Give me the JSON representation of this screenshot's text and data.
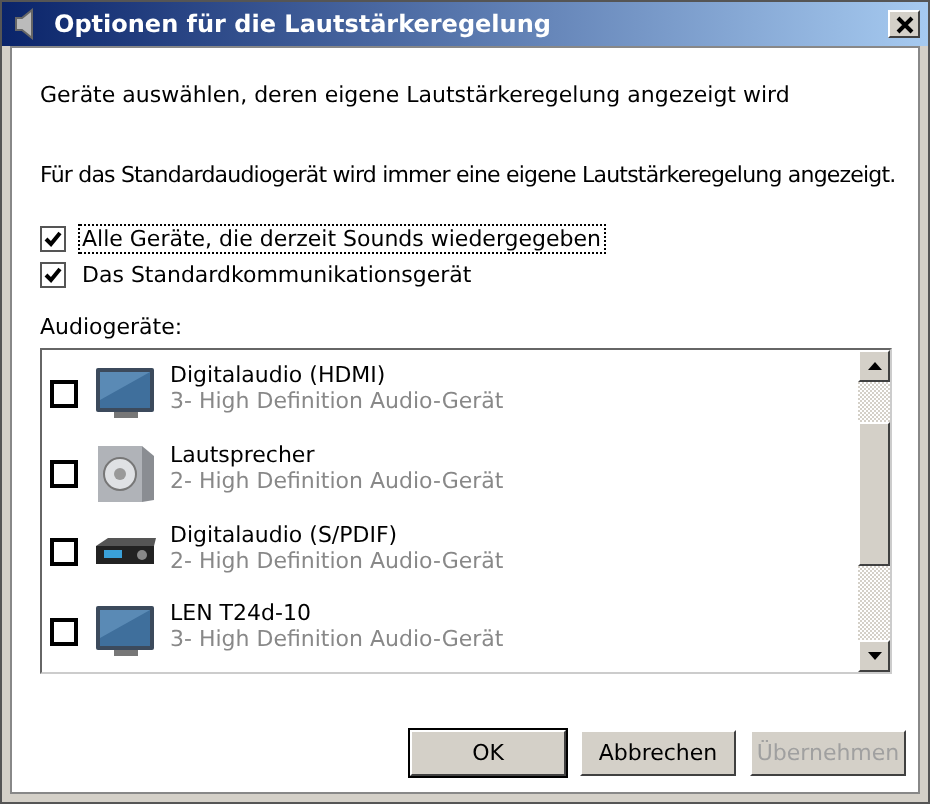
{
  "window": {
    "title": "Optionen für die Lautstärkeregelung"
  },
  "intro": "Geräte auswählen, deren eigene Lautstärkeregelung angezeigt wird",
  "note": "Für das Standardaudiogerät wird immer eine eigene Lautstärkeregelung angezeigt.",
  "options": [
    {
      "label": "Alle Geräte, die derzeit Sounds wiedergegeben",
      "checked": true,
      "focused": true
    },
    {
      "label": "Das Standardkommunikationsgerät",
      "checked": true,
      "focused": false
    }
  ],
  "devices_label": "Audiogeräte:",
  "devices": [
    {
      "kind": "monitor",
      "name": "Digitalaudio (HDMI)",
      "detail": "3- High Definition Audio-Gerät",
      "checked": false
    },
    {
      "kind": "speaker",
      "name": "Lautsprecher",
      "detail": "2- High Definition Audio-Gerät",
      "checked": false
    },
    {
      "kind": "receiver",
      "name": "Digitalaudio (S/PDIF)",
      "detail": "2- High Definition Audio-Gerät",
      "checked": false
    },
    {
      "kind": "monitor",
      "name": "LEN T24d-10",
      "detail": "3- High Definition Audio-Gerät",
      "checked": false
    }
  ],
  "buttons": [
    {
      "label": "OK",
      "disabled": false,
      "default": true
    },
    {
      "label": "Abbrechen",
      "disabled": false,
      "default": false
    },
    {
      "label": "Übernehmen",
      "disabled": true,
      "default": false
    }
  ]
}
